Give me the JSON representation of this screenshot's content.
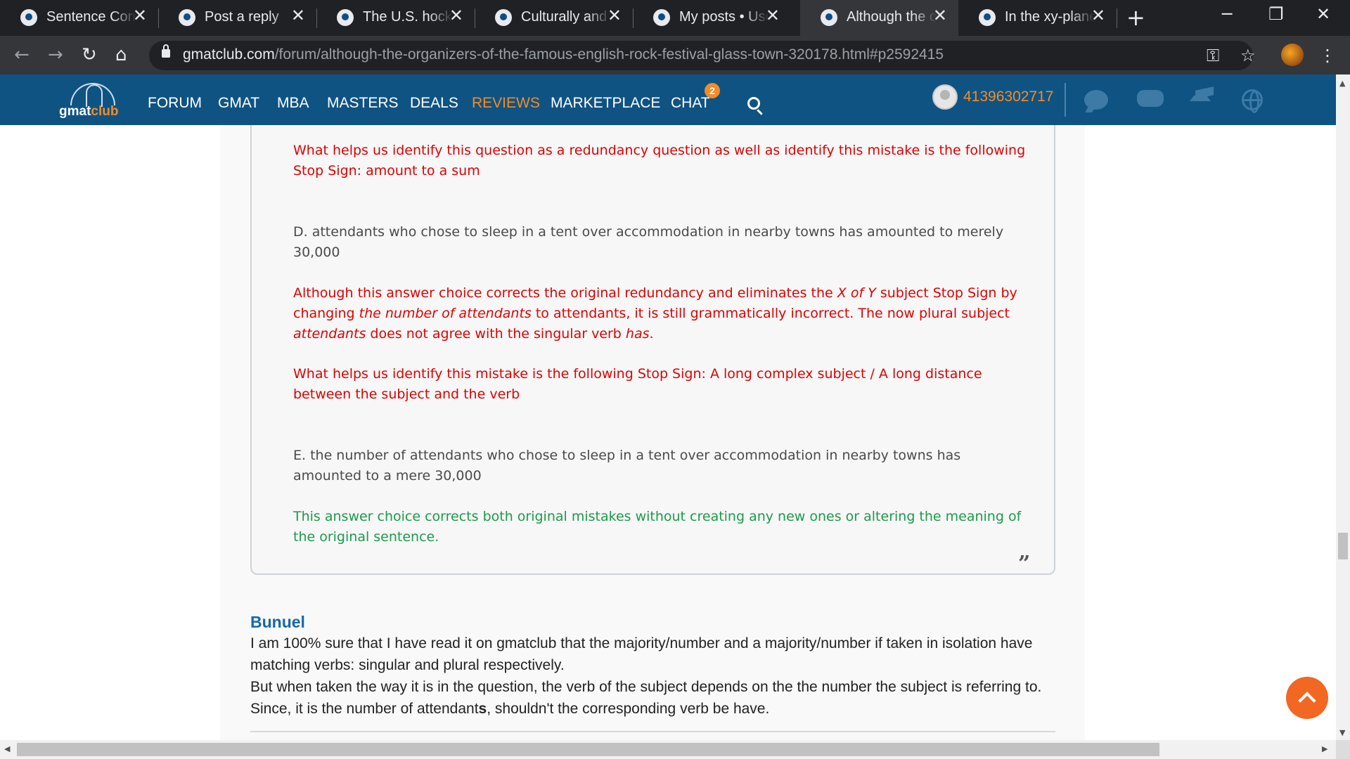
{
  "browser": {
    "tabs": [
      {
        "title": "Sentence Correction",
        "active": false
      },
      {
        "title": "Post a reply",
        "active": false
      },
      {
        "title": "The U.S. hockey",
        "active": false
      },
      {
        "title": "Culturally and politically",
        "active": false
      },
      {
        "title": "My posts • User",
        "active": false
      },
      {
        "title": "Although the organizers",
        "active": true
      },
      {
        "title": "In the xy-plane,",
        "active": false
      }
    ],
    "close_glyph": "✕",
    "newtab_glyph": "+",
    "win_min": "─",
    "win_max": "❐",
    "win_close": "✕",
    "nav": {
      "back": "←",
      "forward": "→",
      "reload": "↻",
      "home": "⌂"
    },
    "url_host": "gmatclub.com",
    "url_path": "/forum/although-the-organizers-of-the-famous-english-rock-festival-glass-town-320178.html#p2592415",
    "key_icon": "⚿",
    "star_icon": "☆",
    "menu_icon": "⋮"
  },
  "site": {
    "logo_main": "gmat",
    "logo_accent": "club",
    "menu": [
      "FORUM",
      "GMAT",
      "MBA",
      "MASTERS",
      "DEALS",
      "REVIEWS",
      "MARKETPLACE",
      "CHAT"
    ],
    "chat_badge": "2",
    "username": "41396302717",
    "accent_color": "#f28c28",
    "header_color": "#0f5383"
  },
  "quote": {
    "p1": "What helps us identify this question as a redundancy question as well as identify this mistake is the following Stop Sign: amount to a sum",
    "p2": "D. attendants who chose to sleep in a tent over accommodation in nearby towns has amounted to merely 30,000",
    "p3_a": "Although this answer choice corrects the original redundancy and eliminates the ",
    "p3_b": "X of Y",
    "p3_c": " subject Stop Sign by changing ",
    "p3_d": "the number of attendants",
    "p3_e": " to attendants, it is still grammatically incorrect. The now plural subject ",
    "p3_f": "attendants",
    "p3_g": " does not agree with the singular verb ",
    "p3_h": "has",
    "p3_i": ".",
    "p4": "What helps us identify this mistake is the following Stop Sign: A long complex subject / A long distance between the subject and the verb",
    "p5": "E. the number of attendants who chose to sleep in a tent over accommodation in nearby towns has amounted to a mere 30,000",
    "p6": "This answer choice corrects both original mistakes without creating any new ones or altering the meaning of the original sentence.",
    "close_mark": "”"
  },
  "post": {
    "author": "Bunuel",
    "line1": "I am 100% sure that I have read it on gmatclub that the majority/number and a majority/number if taken in isolation have matching verbs: singular and plural respectively.",
    "line2": "But when taken the way it is in the question, the verb of the subject depends on the the number the subject is referring to.",
    "line3_a": "Since, it is the number of attendant",
    "line3_b": "s",
    "line3_c": ", shouldn't the corresponding verb be have."
  }
}
